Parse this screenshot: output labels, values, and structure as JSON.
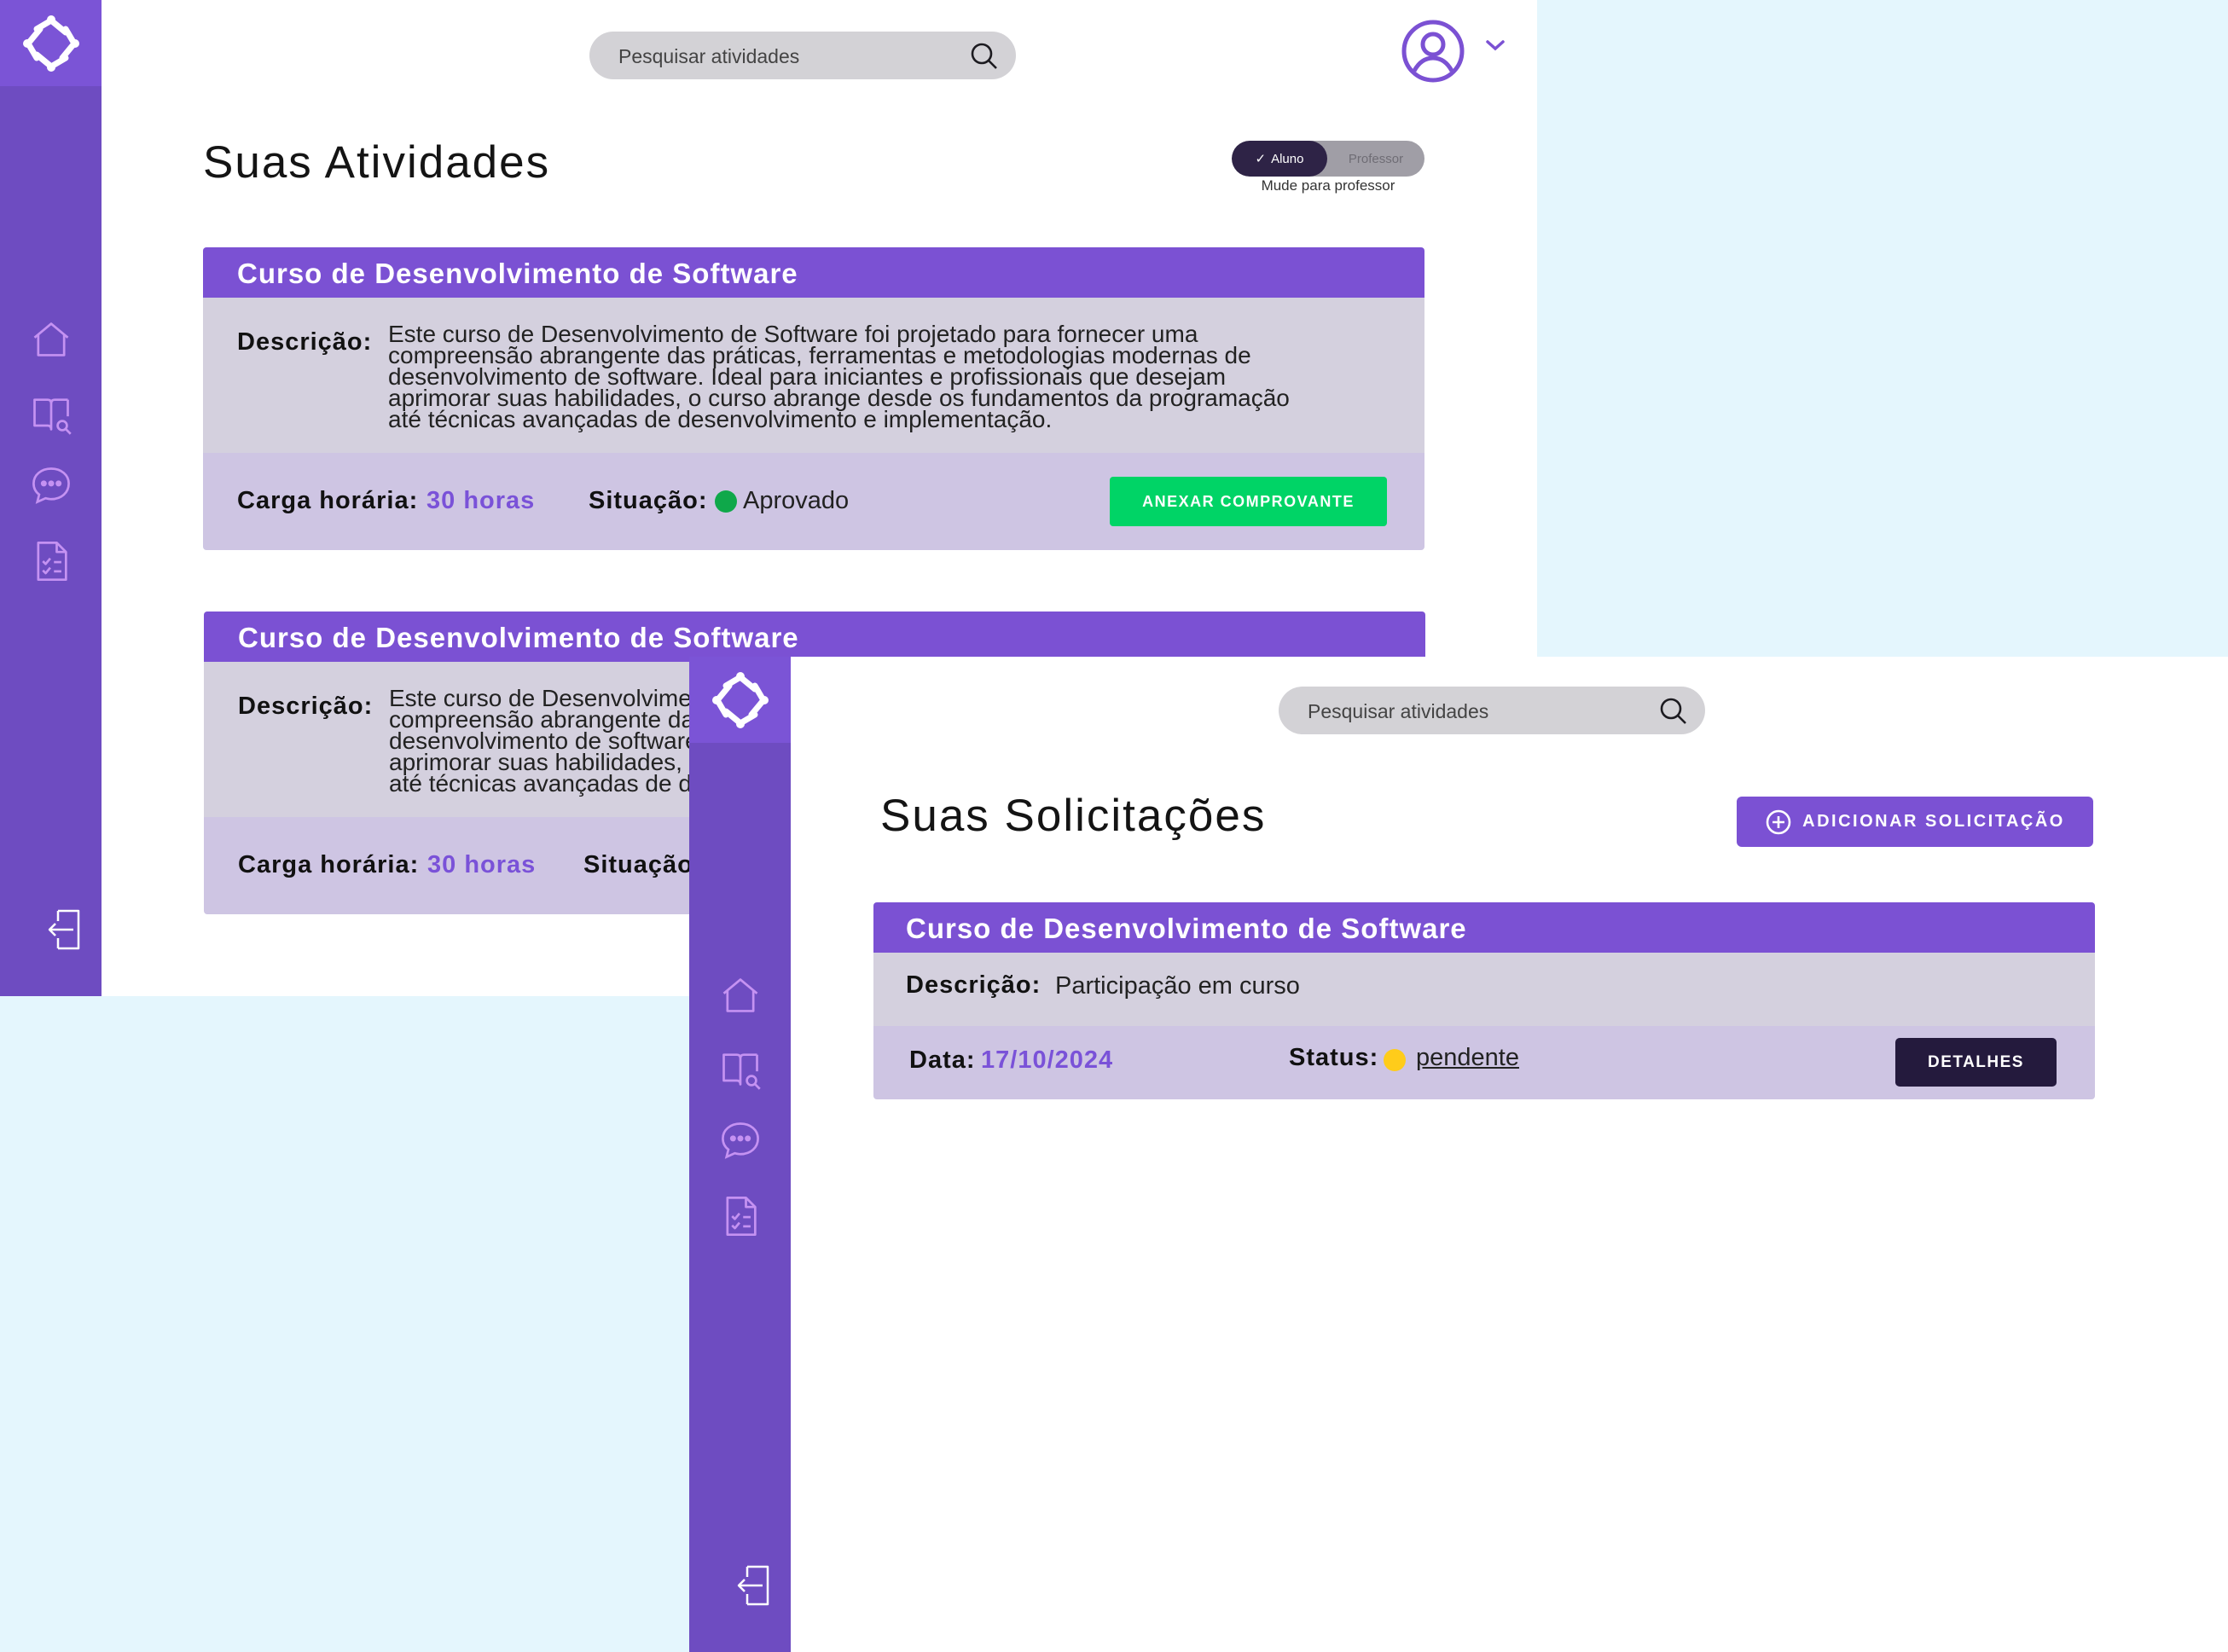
{
  "screen1": {
    "search": {
      "placeholder": "Pesquisar atividades"
    },
    "page_title": "Suas Atividades",
    "role_toggle": {
      "selected": "Aluno",
      "other": "Professor",
      "caption": "Mude para professor"
    },
    "cards": [
      {
        "title": "Curso de Desenvolvimento de Software",
        "description_label": "Descrição:",
        "description_lines": [
          "Este curso de Desenvolvimento de Software foi projetado para fornecer uma",
          "compreensão abrangente das práticas, ferramentas e metodologias modernas de",
          "desenvolvimento de software. Ideal para iniciantes e profissionais que desejam",
          "aprimorar suas habilidades, o curso abrange desde os fundamentos da programação",
          "até técnicas avançadas de desenvolvimento e implementação."
        ],
        "workload_label": "Carga horária:",
        "workload_value": "30 horas",
        "status_label": "Situação:",
        "status_value": "Aprovado",
        "status_color": "#0fa84a",
        "action_label": "ANEXAR COMPROVANTE"
      },
      {
        "title": "Curso de Desenvolvimento de Software",
        "description_label": "Descrição:",
        "description_lines": [
          "Este curso de Desenvolvimento de Software foi projetado para fornecer uma",
          "compreensão abrangente das práticas, ferramentas e metodologias modernas de",
          "desenvolvimento de software. Ideal para iniciantes e profissionais que desejam",
          "aprimorar suas habilidades, o curso abrange desde os fundamentos da programação",
          "até técnicas avançadas de desenvolvimento e implementação."
        ],
        "workload_label": "Carga horária:",
        "workload_value": "30 horas",
        "status_label": "Situação:"
      }
    ]
  },
  "screen2": {
    "search": {
      "placeholder": "Pesquisar atividades"
    },
    "page_title": "Suas Solicitações",
    "add_button_label": "ADICIONAR SOLICITAÇÃO",
    "request": {
      "title": "Curso de Desenvolvimento de Software",
      "description_label": "Descrição:",
      "description": "Participação em curso",
      "date_label": "Data:",
      "date_value": "17/10/2024",
      "status_label": "Status:",
      "status_value": "pendente",
      "status_color": "#ffcc1a",
      "details_label": "DETALHES"
    }
  },
  "colors": {
    "sidebar": "#6e4cc1",
    "logo_box": "#7b54d6",
    "card_header": "#7b51d3",
    "nav_icon": "#c592f2",
    "accent_value": "#7a52d8",
    "primary_green": "#00d466",
    "dark_button": "#241a3d",
    "backdrop": "#e4f6fd"
  }
}
